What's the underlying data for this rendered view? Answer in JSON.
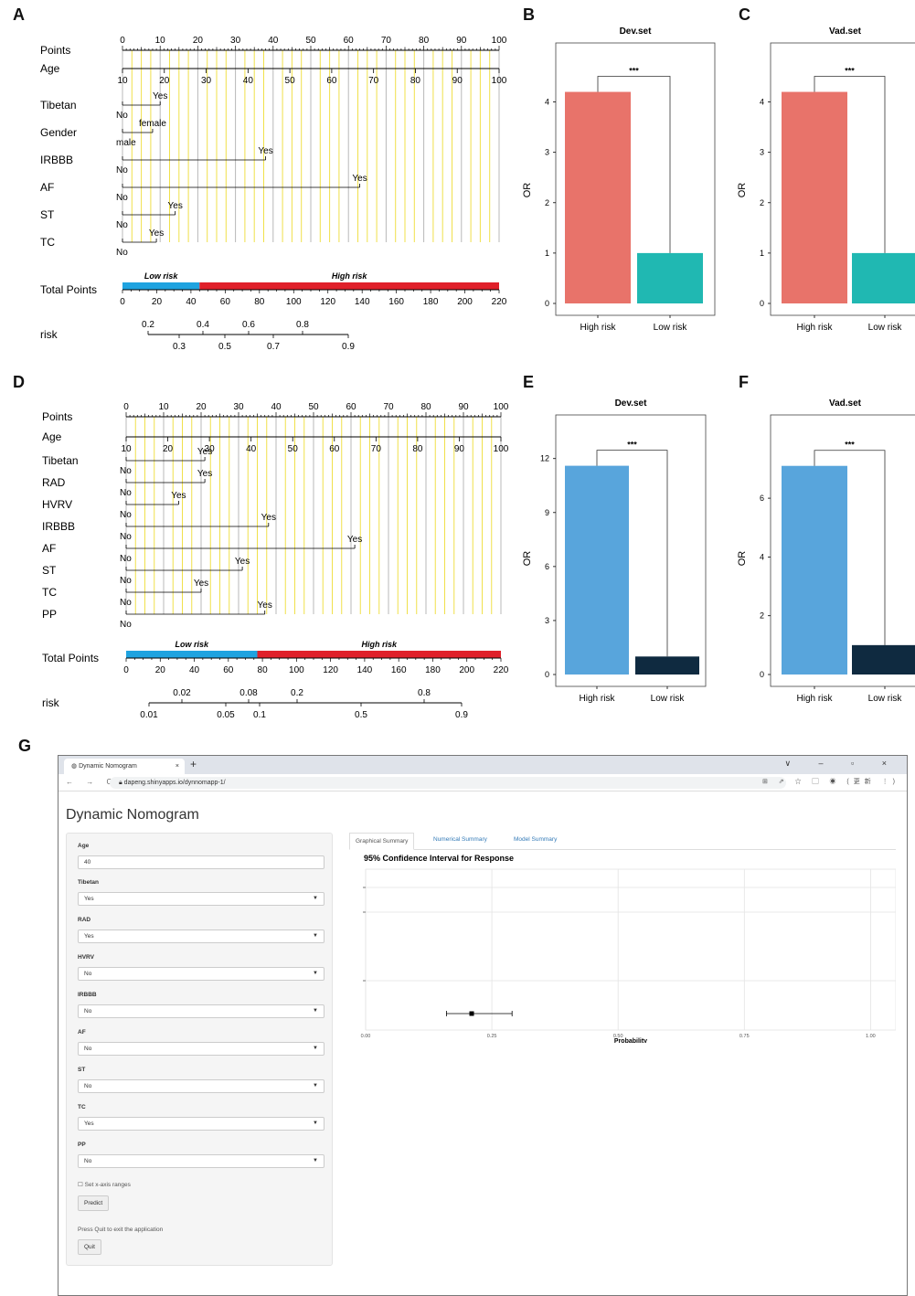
{
  "panel_letters": [
    "A",
    "B",
    "C",
    "D",
    "E",
    "F",
    "G"
  ],
  "chart_data": [
    {
      "type": "nomogram",
      "panel": "A",
      "points_ticks": [
        "0",
        "10",
        "20",
        "30",
        "40",
        "50",
        "60",
        "70",
        "80",
        "90",
        "100"
      ],
      "variables": [
        {
          "name": "Points"
        },
        {
          "name": "Age",
          "ticks": [
            "10",
            "20",
            "30",
            "40",
            "50",
            "60",
            "70",
            "80",
            "90",
            "100"
          ]
        },
        {
          "name": "Tibetan",
          "levels": [
            "No",
            "Yes"
          ],
          "points": [
            0,
            10
          ]
        },
        {
          "name": "Gender",
          "levels": [
            "male",
            "female"
          ],
          "points": [
            0,
            8
          ]
        },
        {
          "name": "IRBBB",
          "levels": [
            "No",
            "Yes"
          ],
          "points": [
            0,
            38
          ]
        },
        {
          "name": "AF",
          "levels": [
            "No",
            "Yes"
          ],
          "points": [
            0,
            63
          ]
        },
        {
          "name": "ST",
          "levels": [
            "No",
            "Yes"
          ],
          "points": [
            0,
            14
          ]
        },
        {
          "name": "TC",
          "levels": [
            "No",
            "Yes"
          ],
          "points": [
            0,
            9
          ]
        }
      ],
      "total_points": {
        "label": "Total Points",
        "ticks": [
          "0",
          "20",
          "40",
          "60",
          "80",
          "100",
          "120",
          "140",
          "160",
          "180",
          "200",
          "220"
        ],
        "low_label": "Low risk",
        "high_label": "High risk",
        "cutoff": 45
      },
      "risk": {
        "label": "risk",
        "top_ticks": [
          "0.2",
          "0.4",
          "0.6",
          "0.8"
        ],
        "bottom_ticks": [
          "0.3",
          "0.5",
          "0.7",
          "0.9"
        ]
      }
    },
    {
      "type": "bar",
      "panel": "B",
      "title": "Dev.set",
      "ylabel": "OR",
      "categories": [
        "High risk",
        "Low risk"
      ],
      "values": [
        4.2,
        1.0
      ],
      "colors": [
        "#e8736a",
        "#20b8b2"
      ],
      "ylim": [
        0,
        4.5
      ],
      "yticks": [
        "0",
        "1",
        "2",
        "3",
        "4"
      ],
      "significance": "***"
    },
    {
      "type": "bar",
      "panel": "C",
      "title": "Vad.set",
      "ylabel": "OR",
      "categories": [
        "High risk",
        "Low risk"
      ],
      "values": [
        4.2,
        1.0
      ],
      "colors": [
        "#e8736a",
        "#20b8b2"
      ],
      "ylim": [
        0,
        4.5
      ],
      "yticks": [
        "0",
        "1",
        "2",
        "3",
        "4"
      ],
      "significance": "***"
    },
    {
      "type": "nomogram",
      "panel": "D",
      "points_ticks": [
        "0",
        "10",
        "20",
        "30",
        "40",
        "50",
        "60",
        "70",
        "80",
        "90",
        "100"
      ],
      "variables": [
        {
          "name": "Points"
        },
        {
          "name": "Age",
          "ticks": [
            "10",
            "20",
            "30",
            "40",
            "50",
            "60",
            "70",
            "80",
            "90",
            "100"
          ]
        },
        {
          "name": "Tibetan",
          "levels": [
            "No",
            "Yes"
          ],
          "points": [
            0,
            21
          ]
        },
        {
          "name": "RAD",
          "levels": [
            "No",
            "Yes"
          ],
          "points": [
            0,
            21
          ]
        },
        {
          "name": "HVRV",
          "levels": [
            "No",
            "Yes"
          ],
          "points": [
            0,
            14
          ]
        },
        {
          "name": "IRBBB",
          "levels": [
            "No",
            "Yes"
          ],
          "points": [
            0,
            38
          ]
        },
        {
          "name": "AF",
          "levels": [
            "No",
            "Yes"
          ],
          "points": [
            0,
            61
          ]
        },
        {
          "name": "ST",
          "levels": [
            "No",
            "Yes"
          ],
          "points": [
            0,
            31
          ]
        },
        {
          "name": "TC",
          "levels": [
            "No",
            "Yes"
          ],
          "points": [
            0,
            20
          ]
        },
        {
          "name": "PP",
          "levels": [
            "No",
            "Yes"
          ],
          "points": [
            0,
            37
          ]
        }
      ],
      "total_points": {
        "label": "Total Points",
        "ticks": [
          "0",
          "20",
          "40",
          "60",
          "80",
          "100",
          "120",
          "140",
          "160",
          "180",
          "200",
          "220"
        ],
        "low_label": "Low risk",
        "high_label": "High risk",
        "cutoff": 77
      },
      "risk": {
        "label": "risk",
        "top_ticks": [
          "0.02",
          "0.08",
          "0.2",
          "0.8"
        ],
        "bottom_ticks": [
          "0.01",
          "0.05",
          "0.1",
          "0.5",
          "0.9"
        ]
      }
    },
    {
      "type": "bar",
      "panel": "E",
      "title": "Dev.set",
      "ylabel": "OR",
      "categories": [
        "High risk",
        "Low risk"
      ],
      "values": [
        11.6,
        1.0
      ],
      "colors": [
        "#58a5dc",
        "#0f2a40"
      ],
      "ylim": [
        0,
        12.9
      ],
      "yticks": [
        "0",
        "3",
        "6",
        "9",
        "12"
      ],
      "significance": "***"
    },
    {
      "type": "bar",
      "panel": "F",
      "title": "Vad.set",
      "ylabel": "OR",
      "categories": [
        "High risk",
        "Low risk"
      ],
      "values": [
        7.1,
        1.0
      ],
      "colors": [
        "#58a5dc",
        "#0f2a40"
      ],
      "ylim": [
        0,
        7.9
      ],
      "yticks": [
        "0",
        "2",
        "4",
        "6"
      ],
      "significance": "***"
    },
    {
      "type": "scatter",
      "panel": "G",
      "title": "95% Confidence Interval for Response",
      "xlabel": "Probability",
      "xlim": [
        0,
        1.05
      ],
      "xticks": [
        "0.00",
        "0.25",
        "0.50",
        "0.75",
        "1.00"
      ],
      "point": {
        "x": 0.21,
        "lower": 0.16,
        "upper": 0.29
      }
    }
  ],
  "browser": {
    "tab_title": "Dynamic Nomogram",
    "tab_close": "×",
    "new_tab": "+",
    "window_controls": "∨ – ▫ ×",
    "nav_icons": "← → C",
    "url": "dapeng.shinyapps.io/dynnomapp-1/",
    "toolbar_icons": "⊞ ⇗ ☆ ▢ ◉ (更新 ⋮)"
  },
  "app": {
    "title": "Dynamic Nomogram",
    "fields": [
      {
        "label": "Age",
        "value": "40",
        "select": false
      },
      {
        "label": "Tibetan",
        "value": "Yes",
        "select": true
      },
      {
        "label": "RAD",
        "value": "Yes",
        "select": true
      },
      {
        "label": "HVRV",
        "value": "No",
        "select": true
      },
      {
        "label": "IRBBB",
        "value": "No",
        "select": true
      },
      {
        "label": "AF",
        "value": "No",
        "select": true
      },
      {
        "label": "ST",
        "value": "No",
        "select": true
      },
      {
        "label": "TC",
        "value": "Yes",
        "select": true
      },
      {
        "label": "PP",
        "value": "No",
        "select": true
      }
    ],
    "checkbox_label": "Set x-axis ranges",
    "predict_label": "Predict",
    "quit_note": "Press Quit to exit the application",
    "quit_label": "Quit",
    "tabs": [
      "Graphical Summary",
      "Numerical Summary",
      "Model Summary"
    ]
  }
}
